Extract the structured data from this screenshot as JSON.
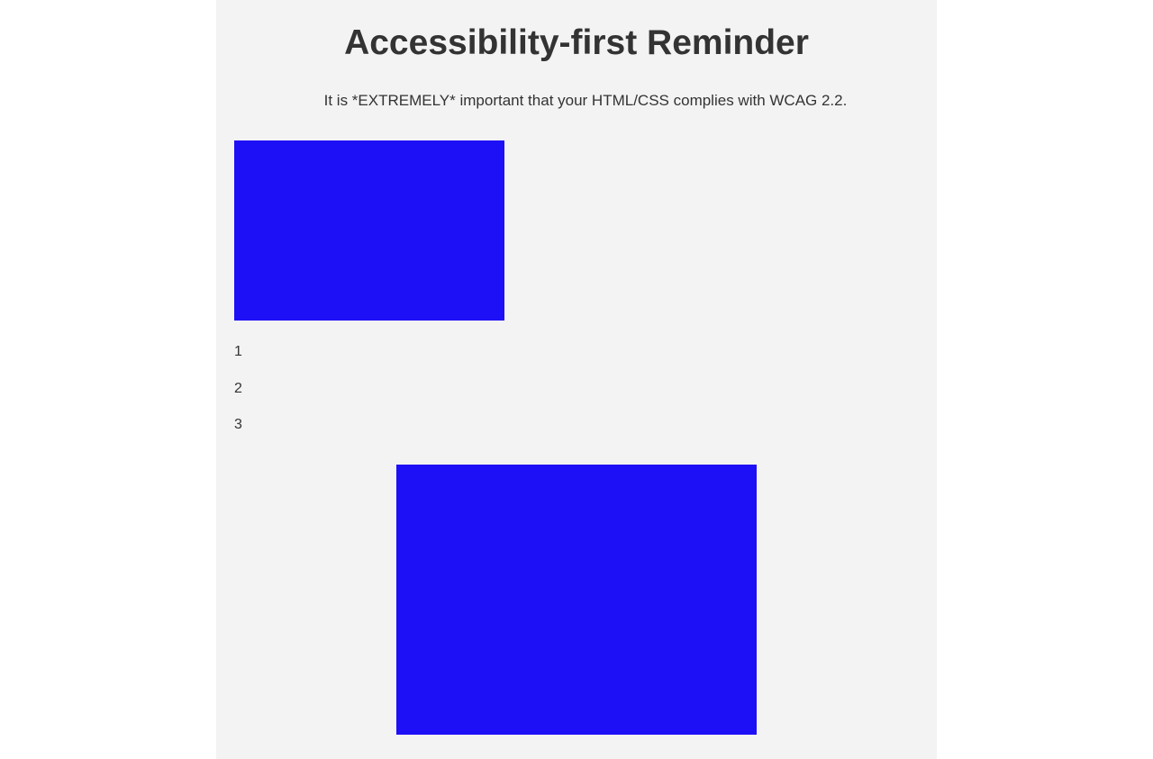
{
  "heading": "Accessibility-first Reminder",
  "message": "It is *EXTREMELY* important that your HTML/CSS complies with WCAG 2.2.",
  "list_items": [
    "1",
    "2",
    "3"
  ],
  "colors": {
    "panel_background": "#f3f3f3",
    "page_background": "#ffffff",
    "text": "#333333",
    "block_fill": "#1e10f6"
  }
}
